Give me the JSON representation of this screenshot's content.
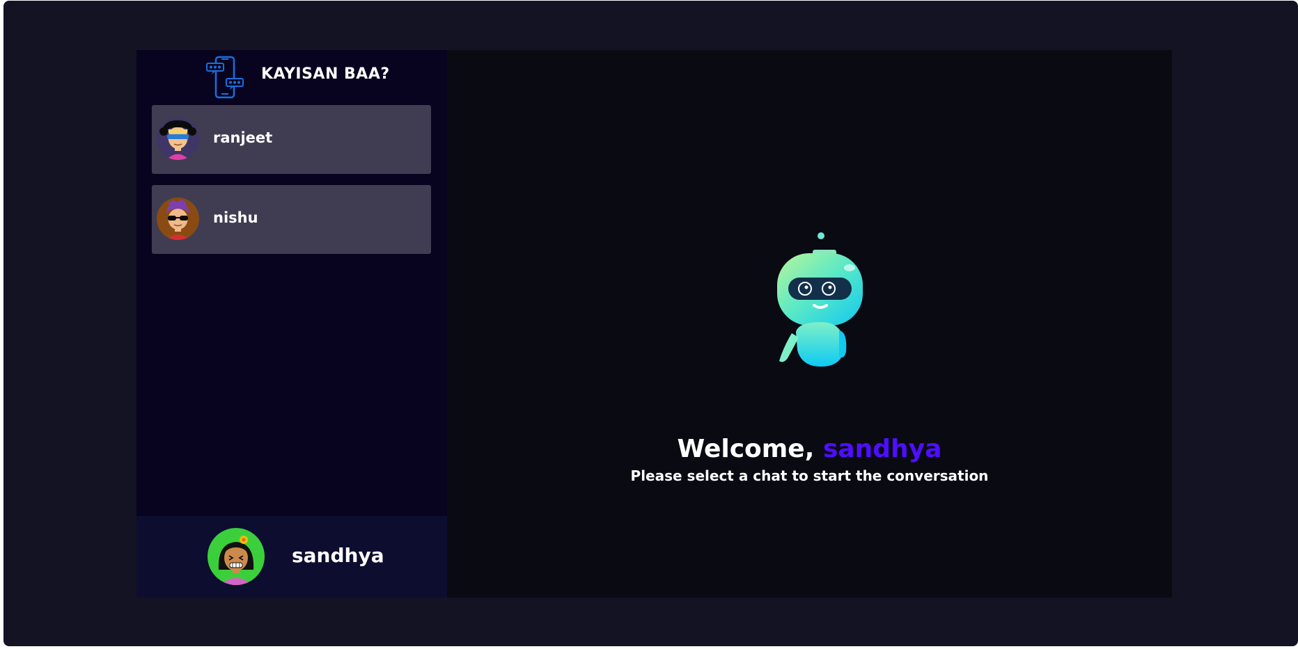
{
  "brand": {
    "title": "KAYISAN BAA?",
    "icon": "chat-phone-logo-icon"
  },
  "contacts": [
    {
      "name": "ranjeet",
      "avatar": "avatar-ranjeet"
    },
    {
      "name": "nishu",
      "avatar": "avatar-nishu"
    }
  ],
  "current_user": {
    "name": "sandhya",
    "avatar": "avatar-sandhya"
  },
  "welcome": {
    "greeting": "Welcome,",
    "username": "sandhya",
    "subtitle": "Please select a chat to start the conversation",
    "illustration": "robot-icon"
  },
  "colors": {
    "background": "#131324",
    "sidebar": "#080420",
    "contact_card": "#403d53",
    "current_user_bar": "#0d0d30",
    "main_panel": "#0a0a13",
    "accent": "#4e0eff"
  }
}
